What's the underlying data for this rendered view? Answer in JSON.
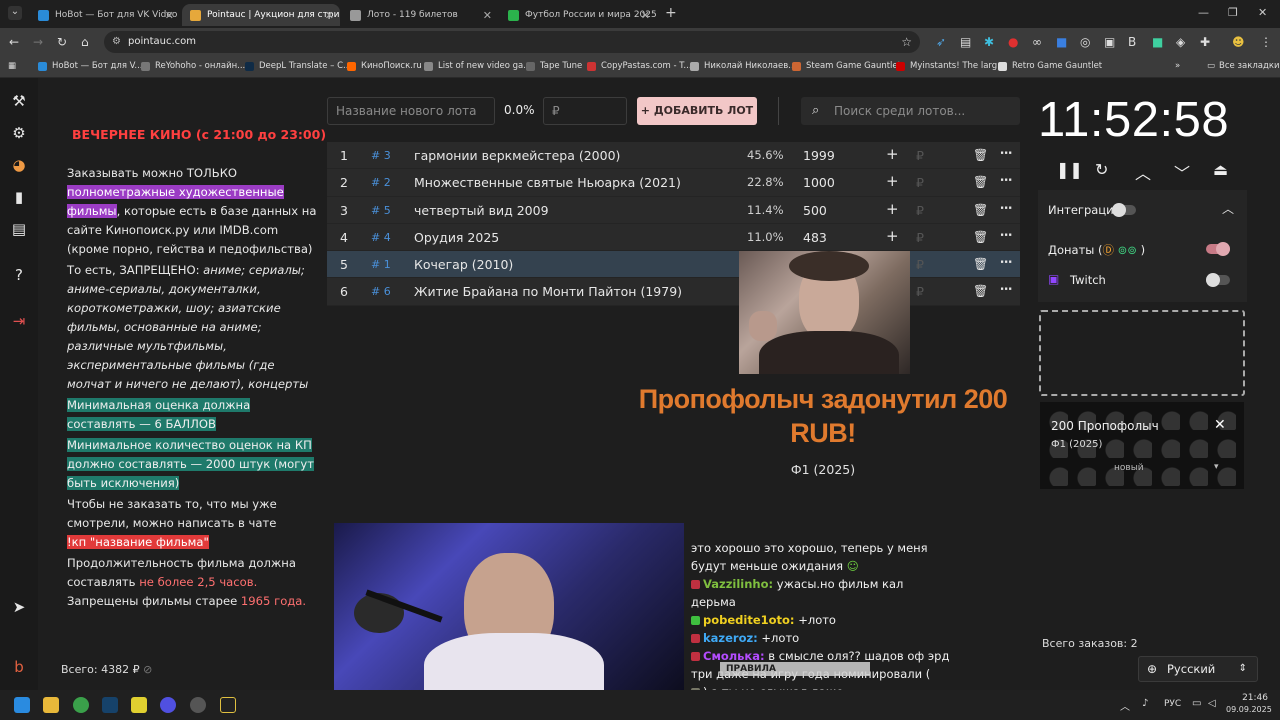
{
  "tabs": [
    {
      "title": "HoBot — Бот для VK Video Liv",
      "color": "#2a8bd8",
      "active": false
    },
    {
      "title": "Pointauc | Аукцион для стрим",
      "color": "#e6a83b",
      "active": true
    },
    {
      "title": "Лото - 119 билетов",
      "color": "#999999",
      "active": false
    },
    {
      "title": "Футбол России и мира 2025 -",
      "color": "#2bb24c",
      "active": false
    }
  ],
  "window_controls": {
    "minimize": "—",
    "restore": "❐",
    "close": "✕",
    "new_tab": "+",
    "tab_menu": "⌄"
  },
  "address": {
    "url": "pointauc.com"
  },
  "bookmarks": [
    {
      "label": "HoBot — Бот для V...",
      "color": "#2a8bd8"
    },
    {
      "label": "ReYohoho - онлайн...",
      "color": "#777"
    },
    {
      "label": "DeepL Translate – C...",
      "color": "#0f2b46"
    },
    {
      "label": "КиноПоиск.ru",
      "color": "#ff6600"
    },
    {
      "label": "List of new video ga...",
      "color": "#888"
    },
    {
      "label": "Tape Tune",
      "color": "#666"
    },
    {
      "label": "CopyPastas.com - T...",
      "color": "#cc3333"
    },
    {
      "label": "Николай Николаев...",
      "color": "#aaa"
    },
    {
      "label": "Steam Game Gauntlet",
      "color": "#cc6633"
    },
    {
      "label": "Myinstants! The larg...",
      "color": "#cc0000"
    },
    {
      "label": "Retro Game Gauntlet",
      "color": "#ddd"
    }
  ],
  "all_bookmarks": "Все закладки",
  "rules": {
    "title": "ВЕЧЕРНЕЕ КИНО (с 21:00 до 23:00)",
    "p1_a": "Заказывать можно ТОЛЬКО ",
    "p1_hl": "полнометражные художественные фильмы",
    "p1_b": ", которые есть в базе данных на сайте Кинопоиск.ру или IMDB.com (кроме порно, гейства и педофильства)",
    "p2_a": "То есть, ЗАПРЕЩЕНО: ",
    "p2_it": "аниме; сериалы; аниме-сериалы, документалки, короткометражки, шоу; азиатские фильмы, основанные на аниме; различные мультфильмы, экспериментальные фильмы (где молчат и ничего не делают), концерты",
    "p3": "Минимальная оценка должна составлять — 6 БАЛЛОВ",
    "p4": "Минимальное количество оценок на КП должно составлять — 2000 штук (могут быть исключения)",
    "p5": "Чтобы не заказать то, что мы уже смотрели, можно написать в чате",
    "p5_cmd": "!кп \"название фильма\"",
    "p6_a": "Продолжительность фильма должна составлять ",
    "p6_red": "не более 2,5 часов.",
    "p6_b": "Запрещены фильмы старее ",
    "p6_year": "1965 года."
  },
  "lot_input": {
    "name_placeholder": "Название нового лота",
    "percent": "0.0%",
    "amount_placeholder": "₽",
    "add_label": "+ ДОБАВИТЬ ЛОТ",
    "search_placeholder": "Поиск среди лотов..."
  },
  "lots": [
    {
      "num": "1",
      "id": "# 3",
      "name": "гармонии веркмейстера (2000)",
      "pct": "45.6%",
      "amount": "1999"
    },
    {
      "num": "2",
      "id": "# 2",
      "name": "Множественные святые Ньюарка (2021)",
      "pct": "22.8%",
      "amount": "1000"
    },
    {
      "num": "3",
      "id": "# 5",
      "name": "четвертый вид 2009",
      "pct": "11.4%",
      "amount": "500"
    },
    {
      "num": "4",
      "id": "# 4",
      "name": "Орудия 2025",
      "pct": "11.0%",
      "amount": "483"
    },
    {
      "num": "5",
      "id": "# 1",
      "name": "Кочегар (2010)",
      "pct": "",
      "amount": ""
    },
    {
      "num": "6",
      "id": "# 6",
      "name": "Житие Брайана по Монти Пайтон (1979)",
      "pct": "",
      "amount": ""
    }
  ],
  "donation": {
    "text": "Пропофолыч задонутил 200 RUB!",
    "sub": "Ф1 (2025)"
  },
  "timer": {
    "time": "11:52:58"
  },
  "integrations": {
    "title": "Интеграции",
    "donations_label": "Донаты (",
    "donations_close": ")",
    "twitch_label": "Twitch"
  },
  "donation_card": {
    "title": "200 Пропофолыч",
    "sub": "Ф1 (2025)",
    "status": "новый"
  },
  "chat": [
    {
      "name": "",
      "text": "это хорошо это хорошо, теперь у меня будут меньше ожидания",
      "color": "#ffffff"
    },
    {
      "name": "Vazzilinho:",
      "text": " ужасы.но фильм кал дерьма",
      "color": "#7fbf3f"
    },
    {
      "name": "pobedite1oto:",
      "text": " +лото",
      "color": "#f0d020"
    },
    {
      "name": "kazeroz:",
      "text": " +лото",
      "color": "#3fa9f5"
    },
    {
      "name": "Смолька:",
      "text": " в смысле оля?? шадов оф эрд три даже на игру года номинировали (",
      "color": "#b44cff"
    },
    {
      "name": "",
      "text": ") а ты не слышал даже",
      "color": "#ffffff"
    }
  ],
  "chat_overlay": "ПРАВИЛА",
  "orders": "Всего заказов: 2",
  "language": "Русский",
  "total": "Всего: 4382 ₽",
  "taskbar": {
    "lang": "РУС",
    "time": "21:46",
    "date": "09.09.2025"
  }
}
